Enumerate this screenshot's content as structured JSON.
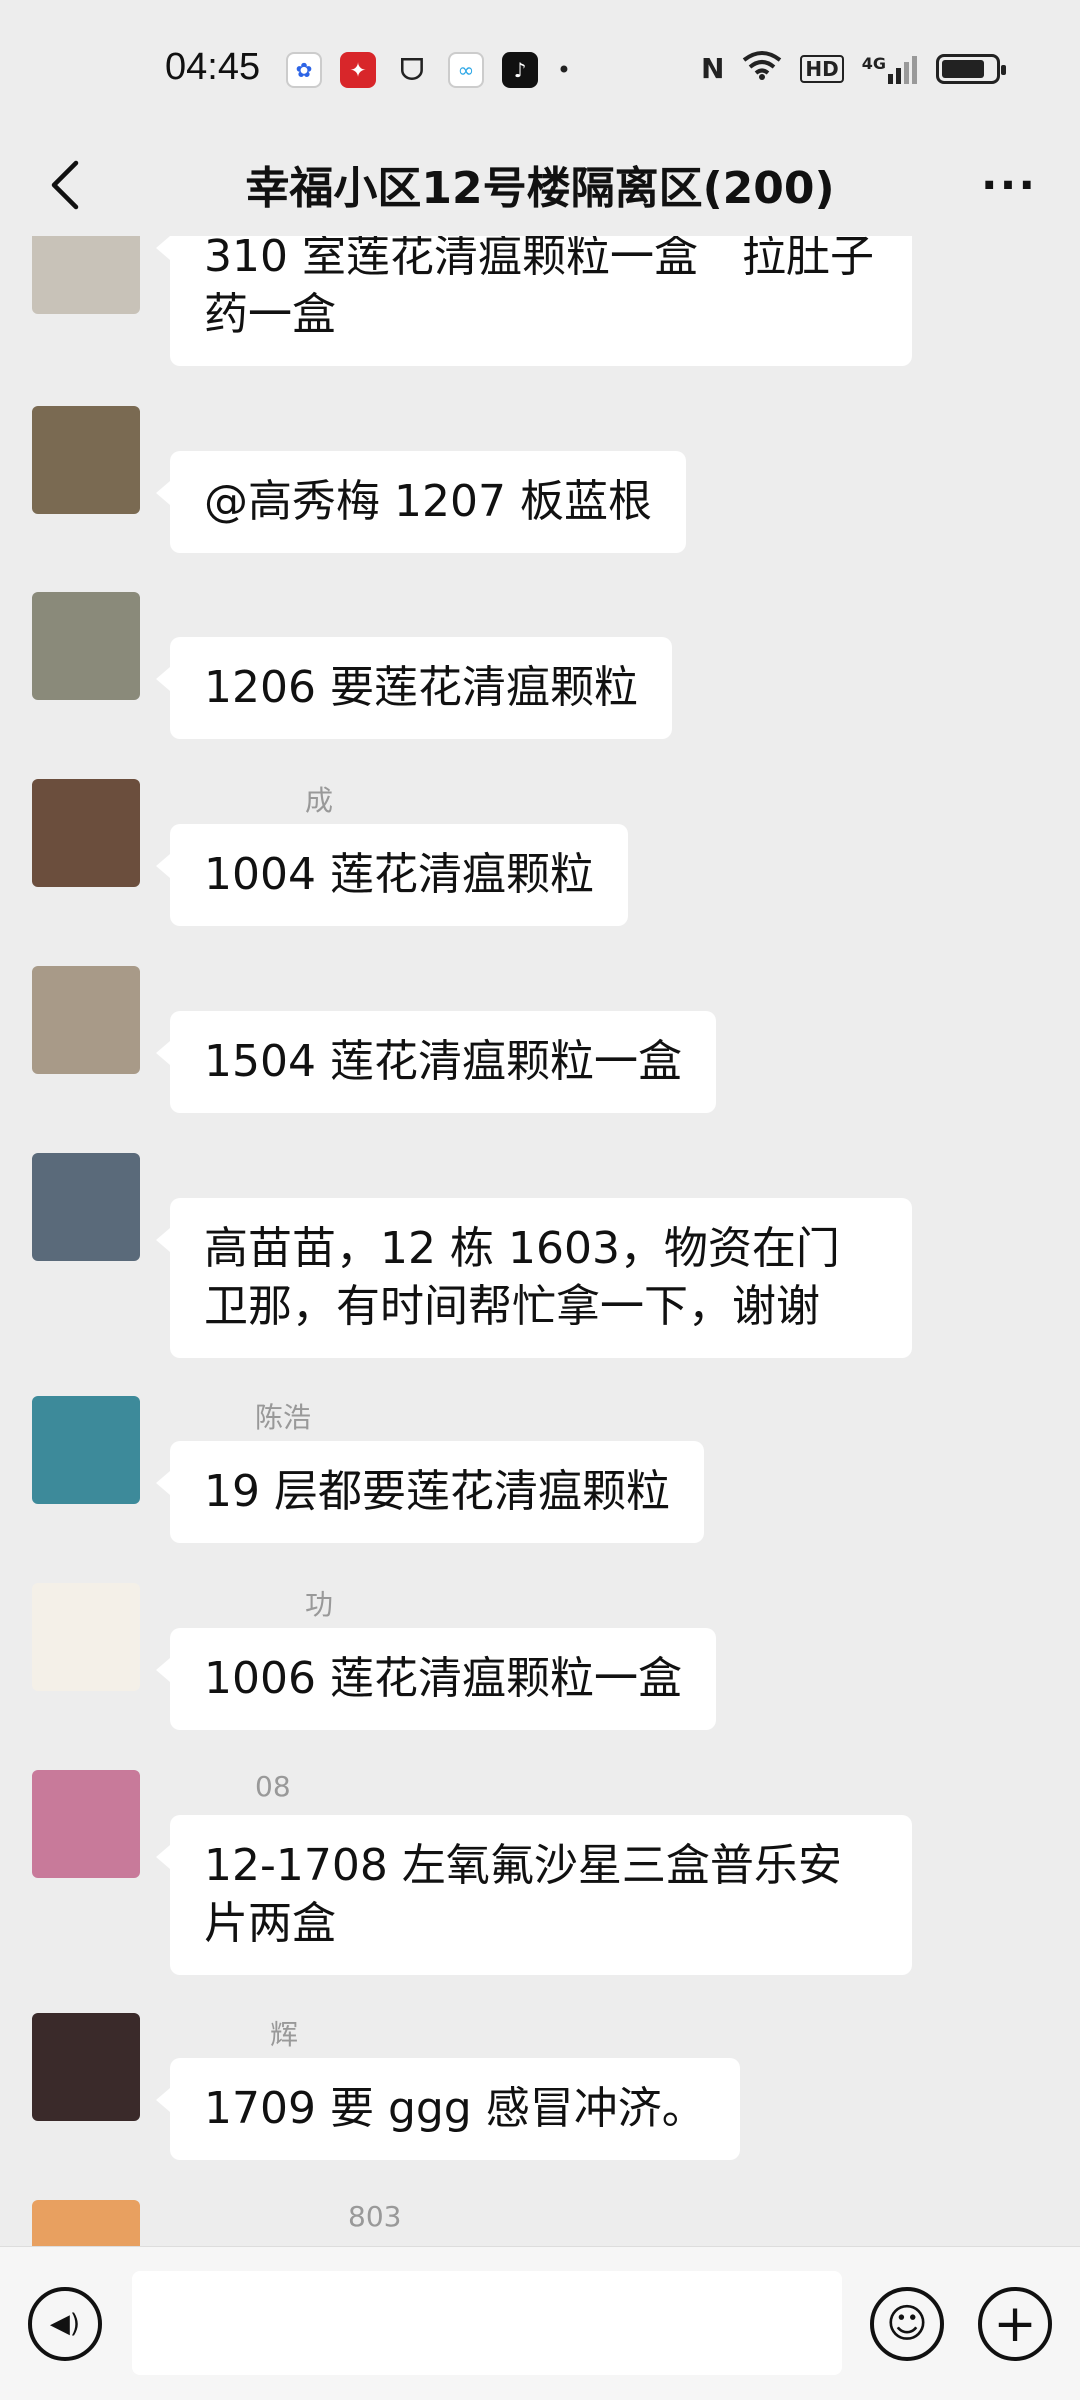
{
  "status_bar": {
    "time": "04:45",
    "notification_icons": [
      "baidu-icon",
      "xuexi-icon",
      "chat-bubble-icon",
      "cloud-app-icon",
      "tiktok-icon",
      "more-dot-icon"
    ],
    "system_icons": [
      "nfc-icon",
      "wifi-icon",
      "hd-icon",
      "signal-4g-icon",
      "battery-icon"
    ],
    "nfc": "N",
    "hd": "HD",
    "network": "4G",
    "battery_level": 0.8
  },
  "header": {
    "title": "幸福小区12号楼隔离区(200)",
    "back_icon": "chevron-left-icon",
    "more_icon": "more-dots-icon",
    "more_glyph": "···"
  },
  "messages": [
    {
      "sender": "",
      "text": "310 室莲花清瘟颗粒一盒　拉肚子药一盒",
      "avatar_color": "#c8c2b8"
    },
    {
      "sender": "",
      "text": "@高秀梅  1207 板蓝根",
      "avatar_color": "#7a6a52"
    },
    {
      "sender": "",
      "text": "1206 要莲花清瘟颗粒",
      "avatar_color": "#8a8a7a"
    },
    {
      "sender": "成",
      "text": "1004 莲花清瘟颗粒",
      "avatar_color": "#6b4e3d"
    },
    {
      "sender": "",
      "text": "1504 莲花清瘟颗粒一盒",
      "avatar_color": "#a89a88"
    },
    {
      "sender": "",
      "text": "高苗苗，12 栋 1603，物资在门卫那，有时间帮忙拿一下，谢谢",
      "avatar_color": "#5a6a7a"
    },
    {
      "sender": "陈浩",
      "text": "19 层都要莲花清瘟颗粒",
      "avatar_color": "#3d8a9a"
    },
    {
      "sender": "功",
      "text": "1006 莲花清瘟颗粒一盒",
      "avatar_color": "#f4f0e8"
    },
    {
      "sender": "08",
      "text": "12-1708 左氧氟沙星三盒普乐安片两盒",
      "avatar_color": "#c87a9a"
    },
    {
      "sender": "辉",
      "text": "1709 要 ggg 感冒冲济。",
      "avatar_color": "#3a2a2a"
    },
    {
      "sender": "803",
      "text": "",
      "avatar_color": "#e8a060"
    }
  ],
  "input_bar": {
    "voice_icon": "voice-icon",
    "voice_glyph": "◀)",
    "input_placeholder": "",
    "emoji_icon": "emoji-icon",
    "emoji_glyph": "☺",
    "plus_icon": "plus-icon",
    "plus_glyph": "+"
  },
  "colors": {
    "background": "#ededed",
    "bubble": "#ffffff",
    "sender_name": "#999999"
  }
}
